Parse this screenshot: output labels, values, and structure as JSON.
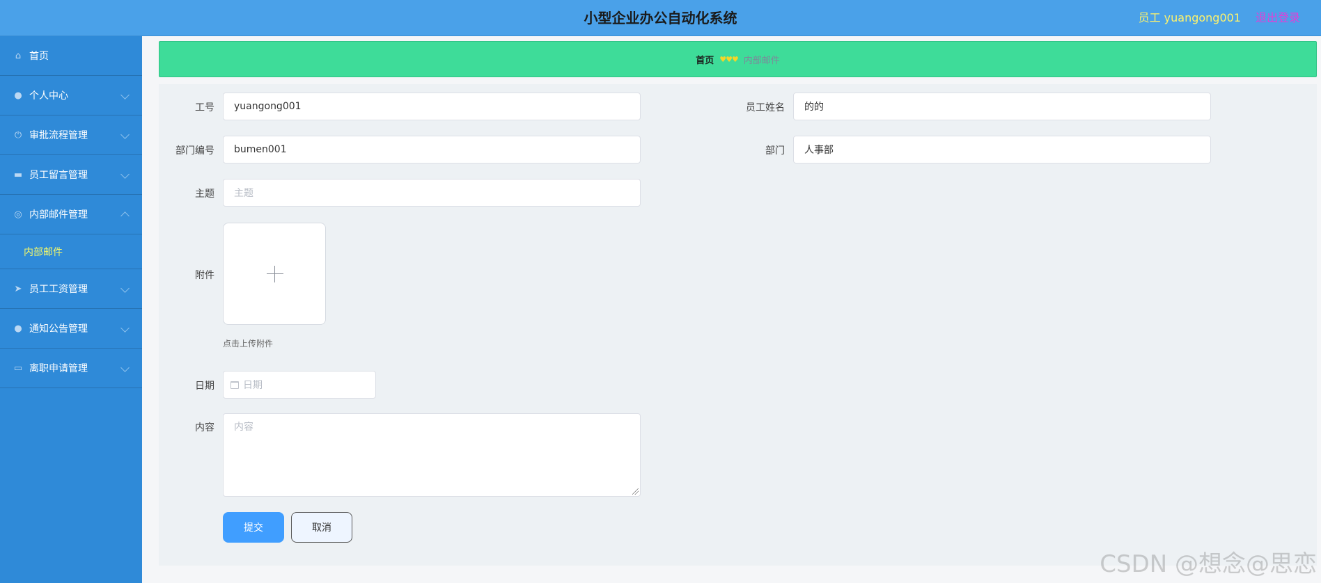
{
  "header": {
    "title": "小型企业办公自动化系统",
    "user": "员工 yuangong001",
    "logout": "退出登录"
  },
  "sidebar": {
    "items": [
      {
        "label": "首页",
        "icon": "home-icon"
      },
      {
        "label": "个人中心",
        "icon": "user-icon"
      },
      {
        "label": "审批流程管理",
        "icon": "power-icon"
      },
      {
        "label": "员工留言管理",
        "icon": "monitor-icon"
      },
      {
        "label": "内部邮件管理",
        "icon": "compass-icon"
      },
      {
        "label": "员工工资管理",
        "icon": "send-icon"
      },
      {
        "label": "通知公告管理",
        "icon": "user-icon"
      },
      {
        "label": "离职申请管理",
        "icon": "card-icon"
      }
    ],
    "submenu_active": "内部邮件"
  },
  "breadcrumb": {
    "home": "首页",
    "separator": "♥♥♥",
    "current": "内部邮件"
  },
  "form": {
    "employee_no": {
      "label": "工号",
      "value": "yuangong001"
    },
    "employee_name": {
      "label": "员工姓名",
      "value": "的的"
    },
    "dept_no": {
      "label": "部门编号",
      "value": "bumen001"
    },
    "dept": {
      "label": "部门",
      "value": "人事部"
    },
    "subject": {
      "label": "主题",
      "placeholder": "主题"
    },
    "attachment": {
      "label": "附件",
      "tip": "点击上传附件"
    },
    "date": {
      "label": "日期",
      "placeholder": "日期"
    },
    "content": {
      "label": "内容",
      "placeholder": "内容"
    },
    "submit": "提交",
    "cancel": "取消"
  },
  "watermark": "CSDN @想念@思恋"
}
